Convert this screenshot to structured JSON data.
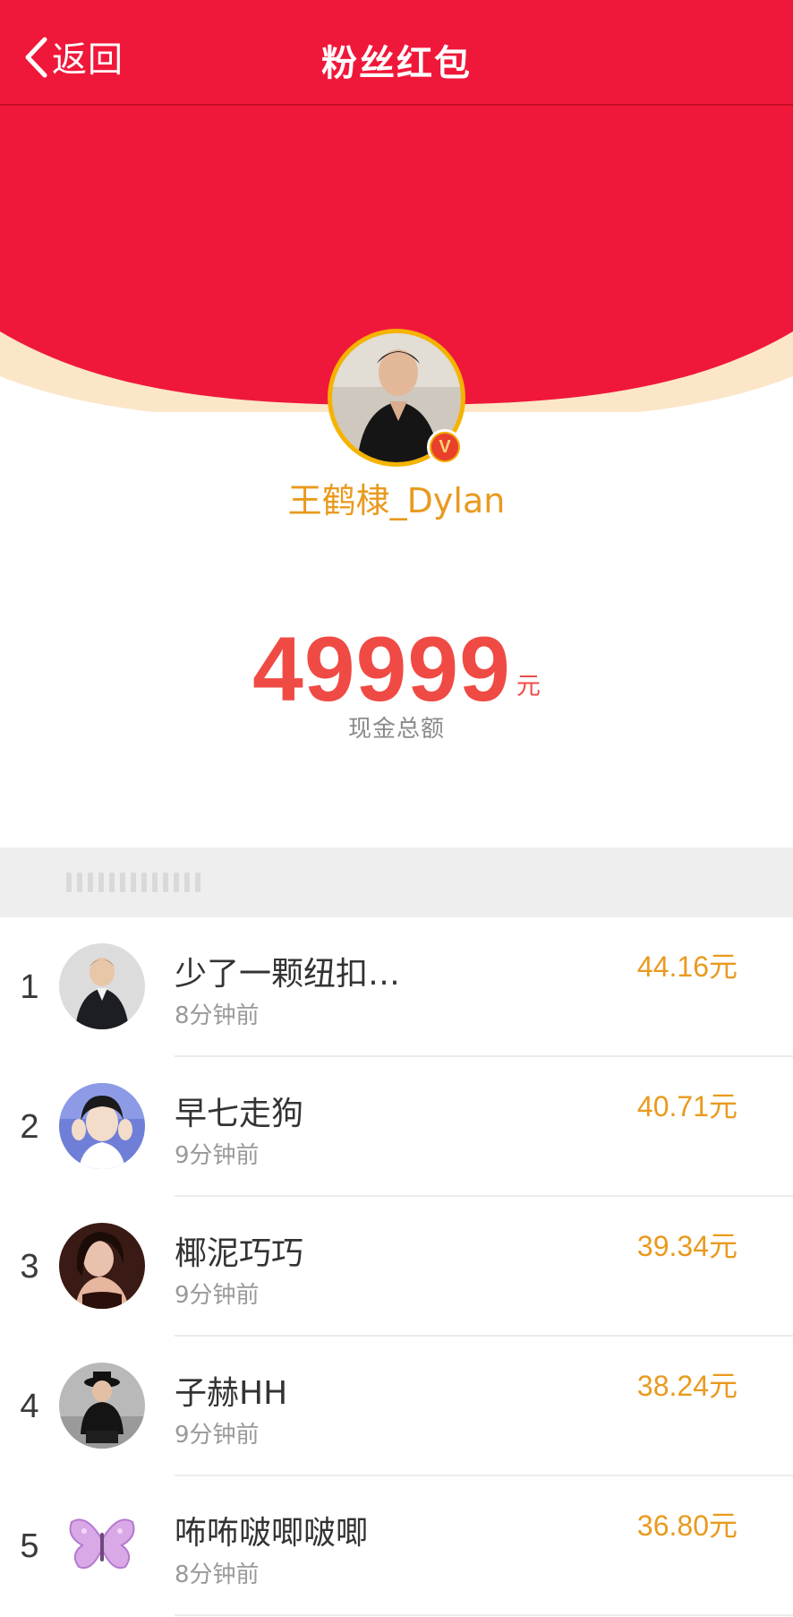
{
  "nav": {
    "back_label": "返回",
    "title": "粉丝红包"
  },
  "sender": {
    "name": "王鹤棣_Dylan",
    "verified_badge": "V"
  },
  "amount": {
    "value": "49999",
    "unit": "元",
    "caption": "现金总额"
  },
  "recipients": [
    {
      "rank": "1",
      "name": "少了一颗纽扣…",
      "time": "8分钟前",
      "amount": "44.16元"
    },
    {
      "rank": "2",
      "name": "早七走狗",
      "time": "9分钟前",
      "amount": "40.71元"
    },
    {
      "rank": "3",
      "name": "椰泥巧巧",
      "time": "9分钟前",
      "amount": "39.34元"
    },
    {
      "rank": "4",
      "name": "子赫HH",
      "time": "9分钟前",
      "amount": "38.24元"
    },
    {
      "rank": "5",
      "name": "咘咘啵唧啵唧",
      "time": "8分钟前",
      "amount": "36.80元"
    }
  ],
  "colors": {
    "header_red": "#f0183a",
    "accent_gold": "#e99a1e",
    "amount_red": "#f04a45"
  }
}
